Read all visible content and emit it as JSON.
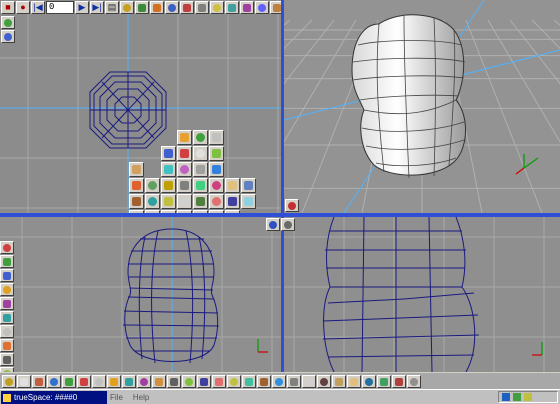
{
  "top_toolbar": {
    "frame_value": "0",
    "buttons": [
      {
        "icon": "stop-icon",
        "glyph": "■",
        "tone": "red"
      },
      {
        "icon": "record-icon",
        "glyph": "●",
        "tone": "red"
      },
      {
        "icon": "rewind-icon",
        "glyph": "|◀",
        "tone": "blue"
      },
      {
        "icon": "play-icon",
        "glyph": "▶",
        "tone": "blue"
      },
      {
        "icon": "fast-forward-icon",
        "glyph": "▶|",
        "tone": "blue"
      },
      {
        "icon": "keyframe-icon",
        "glyph": "▤",
        "tone": ""
      }
    ],
    "object_tool_colors": [
      "#c8a020",
      "#3a8a3a",
      "#d07020",
      "#4060c0",
      "#c04040",
      "#808080",
      "#d0c040",
      "#40a0a0",
      "#a040a0",
      "#6060ff",
      "#c08040",
      "#505050",
      "#3090d0",
      "#e0e0e0",
      "#b02020",
      "#e0a020",
      "#207020",
      "#9090ff",
      "#404040"
    ]
  },
  "tool_panel": {
    "colors": [
      "#e8a030",
      "#40a040",
      "#c0c0c0",
      "#4060d0",
      "#d04040",
      "#e0e0e0",
      "#80c040",
      "#d0a060",
      "#40c0c0",
      "#c060c0",
      "#a0a0a0",
      "#3080e0",
      "#e06030",
      "#60a060",
      "#c0a000",
      "#808080",
      "#40d080",
      "#d04080",
      "#e0c080",
      "#6080c0",
      "#a06030",
      "#30a0a0",
      "#c0c040",
      "#d0d0d0",
      "#508040",
      "#e07070",
      "#4040a0",
      "#90d0e0"
    ]
  },
  "left_side_strip": {
    "colors": [
      "#d04040",
      "#40a040",
      "#4060d0",
      "#e0a020",
      "#a040a0",
      "#30a0a0",
      "#c0c0c0",
      "#e07030",
      "#606060",
      "#90c040",
      "#4090e0"
    ]
  },
  "bottom_toolbar": {
    "colors": [
      "#c0a020",
      "#e0e0e0",
      "#c06040",
      "#3070d0",
      "#40a040",
      "#d04040",
      "#c0c0c0",
      "#e0a020",
      "#30a0a0",
      "#a040a0",
      "#d09040",
      "#606060",
      "#80c040",
      "#4040a0",
      "#e07070",
      "#c0c040",
      "#40c0a0",
      "#a06030",
      "#3090e0",
      "#808080",
      "#d0d0d0",
      "#604040",
      "#c0a060",
      "#e0c080",
      "#2070a0",
      "#40a060",
      "#b04040",
      "#909090"
    ]
  },
  "taskbar": {
    "app_title": "trueSpace: ####0",
    "menu_file": "File",
    "menu_help": "Help"
  },
  "colors": {
    "viewport_divider": "#2f4fd6",
    "wire_color": "#1a1a80",
    "grid_color": "#a8a8a8",
    "axis_blue": "#4fb3ff"
  }
}
